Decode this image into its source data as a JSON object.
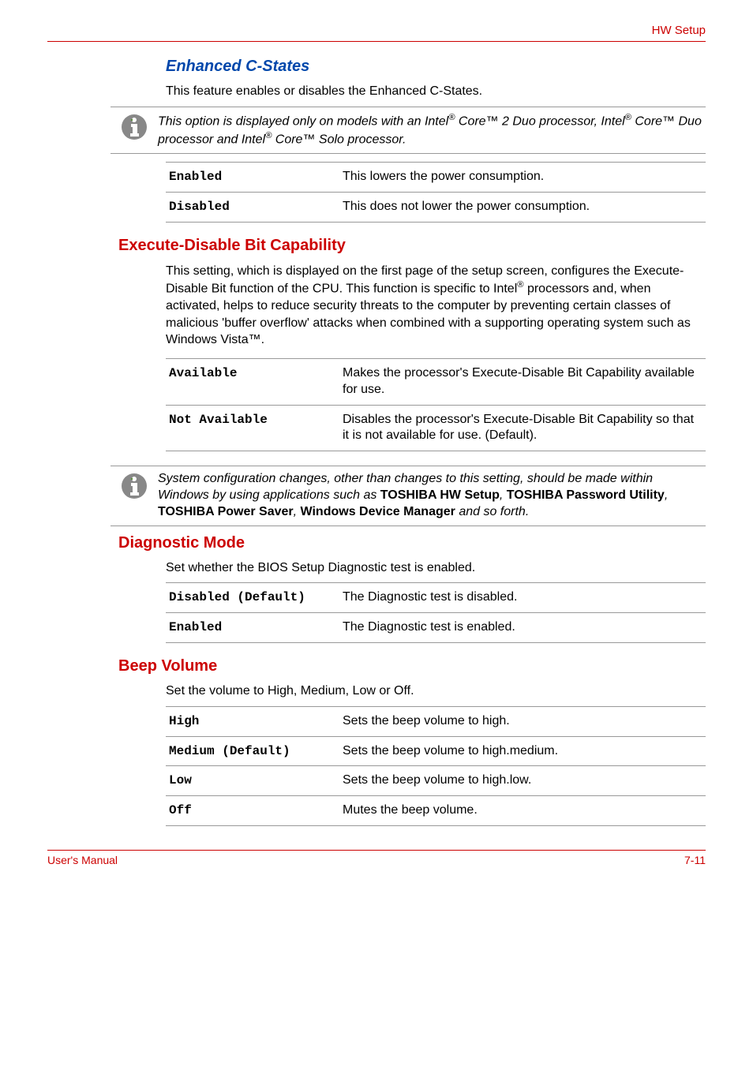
{
  "header": {
    "right_text": "HW Setup"
  },
  "section1": {
    "title": "Enhanced C-States",
    "intro": "This feature enables or disables the Enhanced C-States.",
    "note_html": "This option is displayed only on models with an Intel<sup>®</sup> Core™ 2 Duo processor, Intel<sup>®</sup> Core™ Duo processor and Intel<sup>®</sup> Core™ Solo processor.",
    "rows": [
      {
        "key": "Enabled",
        "desc": "This lowers the power consumption."
      },
      {
        "key": "Disabled",
        "desc": "This does not lower the power consumption."
      }
    ]
  },
  "section2": {
    "heading": "Execute-Disable Bit Capability",
    "body_html": "This setting, which is displayed on the first page of the setup screen, configures the Execute-Disable Bit function of the CPU. This function is specific to Intel<sup>®</sup> processors and, when activated, helps to reduce security threats to the computer by preventing certain classes of malicious 'buffer overflow' attacks when combined with a supporting operating system such as Windows Vista™.",
    "rows": [
      {
        "key": "Available",
        "desc": "Makes the processor's Execute-Disable Bit Capability available for use."
      },
      {
        "key": "Not Available",
        "desc": "Disables the processor's Execute-Disable Bit Capability so that it is not available for use. (Default)."
      }
    ],
    "note_prefix": "System configuration changes, other than changes to this setting, should be made within Windows by using applications such as ",
    "note_bold1": "TOSHIBA HW Setup",
    "note_mid1": ", ",
    "note_bold2": "TOSHIBA Password Utility",
    "note_mid2": ", ",
    "note_bold3": "TOSHIBA Power Saver",
    "note_mid3": ", ",
    "note_bold4": "Windows Device Manager",
    "note_suffix": " and so forth."
  },
  "section3": {
    "heading": "Diagnostic Mode",
    "intro": "Set whether the BIOS Setup Diagnostic test is enabled.",
    "rows": [
      {
        "key": "Disabled (Default)",
        "desc": "The Diagnostic test is disabled."
      },
      {
        "key": "Enabled",
        "desc": "The Diagnostic test is enabled."
      }
    ]
  },
  "section4": {
    "heading": "Beep Volume",
    "intro": "Set the volume to High, Medium, Low or Off.",
    "rows": [
      {
        "key": "High",
        "desc": "Sets the beep volume to high."
      },
      {
        "key": "Medium (Default)",
        "desc": "Sets the beep volume to high.medium."
      },
      {
        "key": "Low",
        "desc": "Sets the beep volume to high.low."
      },
      {
        "key": "Off",
        "desc": "Mutes the beep volume."
      }
    ]
  },
  "footer": {
    "left": "User's Manual",
    "right": "7-11"
  }
}
